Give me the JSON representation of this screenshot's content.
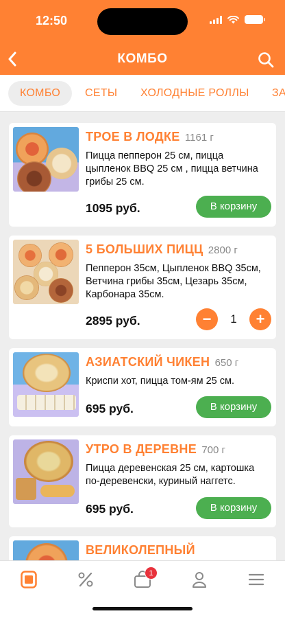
{
  "status_bar": {
    "time": "12:50"
  },
  "header": {
    "title": "КОМБО"
  },
  "tabs": [
    {
      "label": "КОМБО",
      "active": true
    },
    {
      "label": "СЕТЫ",
      "active": false
    },
    {
      "label": "ХОЛОДНЫЕ РОЛЛЫ",
      "active": false
    },
    {
      "label": "ЗА",
      "active": false
    }
  ],
  "products": [
    {
      "name": "ТРОЕ В ЛОДКЕ",
      "weight": "1161 г",
      "description": "Пицца пепперон 25 см, пицца цыпленок BBQ 25 см , пицца ветчина грибы 25 см.",
      "price": "1095 руб.",
      "cart_label": "В корзину"
    },
    {
      "name": "5 БОЛЬШИХ ПИЦЦ",
      "weight": "2800 г",
      "description": "Пепперон 35см, Цыпленок BBQ 35см, Ветчина грибы 35см, Цезарь 35см, Карбонара 35см.",
      "price": "2895 руб.",
      "quantity": "1",
      "minus": "−",
      "plus": "+"
    },
    {
      "name": "АЗИАТСКИЙ ЧИКЕН",
      "weight": "650 г",
      "description": "Криспи хот, пицца том-ям 25 см.",
      "price": "695 руб.",
      "cart_label": "В корзину"
    },
    {
      "name": "УТРО В ДЕРЕВНЕ",
      "weight": "700 г",
      "description": "Пицца деревенская 25 см, картошка по-деревенски, куриный наггетс.",
      "price": "695 руб.",
      "cart_label": "В корзину"
    },
    {
      "name": "ВЕЛИКОЛЕПНЫЙ",
      "weight": ""
    }
  ],
  "bottom_nav": {
    "cart_badge": "1"
  },
  "colors": {
    "accent": "#ff8133",
    "button_green": "#4caf50",
    "badge_red": "#e8323c"
  }
}
